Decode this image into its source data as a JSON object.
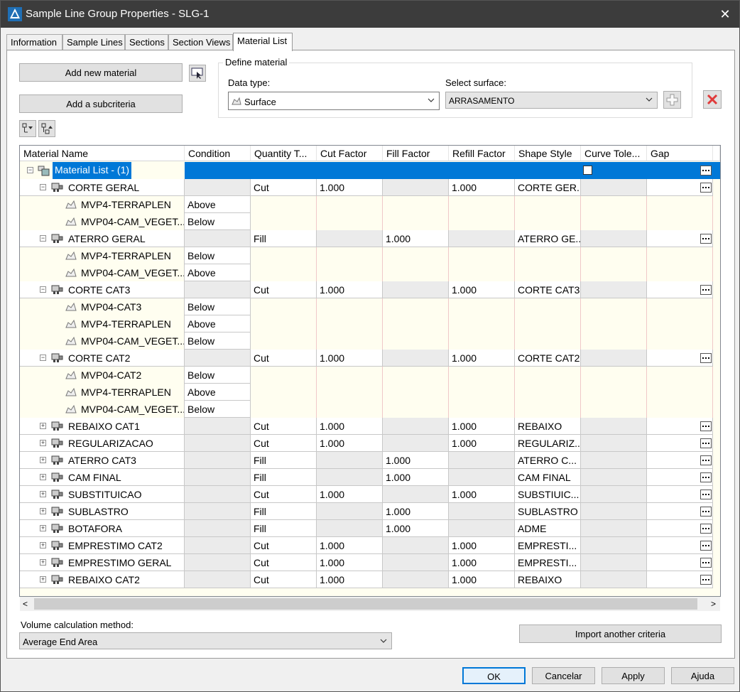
{
  "window": {
    "title": "Sample Line Group Properties - SLG-1",
    "close_glyph": "✕"
  },
  "tabs": [
    {
      "label": "Information"
    },
    {
      "label": "Sample Lines"
    },
    {
      "label": "Sections"
    },
    {
      "label": "Section Views"
    },
    {
      "label": "Material List"
    }
  ],
  "toolbar": {
    "add_material": "Add new material",
    "add_subcriteria": "Add a subcriteria"
  },
  "define_material": {
    "legend": "Define material",
    "data_type_label": "Data type:",
    "data_type_value": "Surface",
    "select_surface_label": "Select surface:",
    "select_surface_value": "ARRASAMENTO"
  },
  "grid": {
    "columns": [
      "Material Name",
      "Condition",
      "Quantity T...",
      "Cut Factor",
      "Fill Factor",
      "Refill Factor",
      "Shape Style",
      "Curve Tole...",
      "Gap"
    ],
    "root_label": "Material List - (1)",
    "rows": [
      {
        "type": "mat",
        "name": "CORTE GERAL",
        "qty": "Cut",
        "cut": "1.000",
        "fill": "",
        "refill": "1.000",
        "style": "CORTE GER..."
      },
      {
        "type": "sub",
        "name": "MVP4-TERRAPLEN",
        "cond": "Above"
      },
      {
        "type": "sub",
        "name": "MVP04-CAM_VEGET...",
        "cond": "Below",
        "last": true
      },
      {
        "type": "mat",
        "name": "ATERRO GERAL",
        "qty": "Fill",
        "cut": "",
        "fill": "1.000",
        "refill": "",
        "style": "ATERRO GE..."
      },
      {
        "type": "sub",
        "name": "MVP4-TERRAPLEN",
        "cond": "Below"
      },
      {
        "type": "sub",
        "name": "MVP04-CAM_VEGET...",
        "cond": "Above",
        "last": true
      },
      {
        "type": "mat",
        "name": "CORTE CAT3",
        "qty": "Cut",
        "cut": "1.000",
        "fill": "",
        "refill": "1.000",
        "style": "CORTE CAT3"
      },
      {
        "type": "sub",
        "name": "MVP04-CAT3",
        "cond": "Below"
      },
      {
        "type": "sub",
        "name": "MVP4-TERRAPLEN",
        "cond": "Above"
      },
      {
        "type": "sub",
        "name": "MVP04-CAM_VEGET...",
        "cond": "Below",
        "last": true
      },
      {
        "type": "mat",
        "name": "CORTE CAT2",
        "qty": "Cut",
        "cut": "1.000",
        "fill": "",
        "refill": "1.000",
        "style": "CORTE CAT2"
      },
      {
        "type": "sub",
        "name": "MVP04-CAT2",
        "cond": "Below"
      },
      {
        "type": "sub",
        "name": "MVP4-TERRAPLEN",
        "cond": "Above"
      },
      {
        "type": "sub",
        "name": "MVP04-CAM_VEGET...",
        "cond": "Below",
        "last": true
      },
      {
        "type": "matc",
        "name": "REBAIXO CAT1",
        "qty": "Cut",
        "cut": "1.000",
        "fill": "",
        "refill": "1.000",
        "style": "REBAIXO"
      },
      {
        "type": "matc",
        "name": "REGULARIZACAO",
        "qty": "Cut",
        "cut": "1.000",
        "fill": "",
        "refill": "1.000",
        "style": "REGULARIZ..."
      },
      {
        "type": "matc",
        "name": "ATERRO CAT3",
        "qty": "Fill",
        "cut": "",
        "fill": "1.000",
        "refill": "",
        "style": "ATERRO C..."
      },
      {
        "type": "matc",
        "name": "CAM FINAL",
        "qty": "Fill",
        "cut": "",
        "fill": "1.000",
        "refill": "",
        "style": "CAM FINAL"
      },
      {
        "type": "matc",
        "name": "SUBSTITUICAO",
        "qty": "Cut",
        "cut": "1.000",
        "fill": "",
        "refill": "1.000",
        "style": "SUBSTIUIC..."
      },
      {
        "type": "matc",
        "name": "SUBLASTRO",
        "qty": "Fill",
        "cut": "",
        "fill": "1.000",
        "refill": "",
        "style": "SUBLASTRO"
      },
      {
        "type": "matc",
        "name": "BOTAFORA",
        "qty": "Fill",
        "cut": "",
        "fill": "1.000",
        "refill": "",
        "style": "ADME"
      },
      {
        "type": "matc",
        "name": "EMPRESTIMO CAT2",
        "qty": "Cut",
        "cut": "1.000",
        "fill": "",
        "refill": "1.000",
        "style": "EMPRESTI..."
      },
      {
        "type": "matc",
        "name": "EMPRESTIMO GERAL",
        "qty": "Cut",
        "cut": "1.000",
        "fill": "",
        "refill": "1.000",
        "style": "EMPRESTI..."
      },
      {
        "type": "matc",
        "name": "REBAIXO CAT2",
        "qty": "Cut",
        "cut": "1.000",
        "fill": "",
        "refill": "1.000",
        "style": "REBAIXO"
      }
    ]
  },
  "volume": {
    "label": "Volume calculation method:",
    "value": "Average End Area"
  },
  "import_button": "Import another criteria",
  "footer": {
    "ok": "OK",
    "cancel": "Cancelar",
    "apply": "Apply",
    "help": "Ajuda"
  },
  "colors": {
    "selection": "#0078d7",
    "delete_icon": "#e03a3a",
    "title_bar": "#3c3c3c"
  }
}
